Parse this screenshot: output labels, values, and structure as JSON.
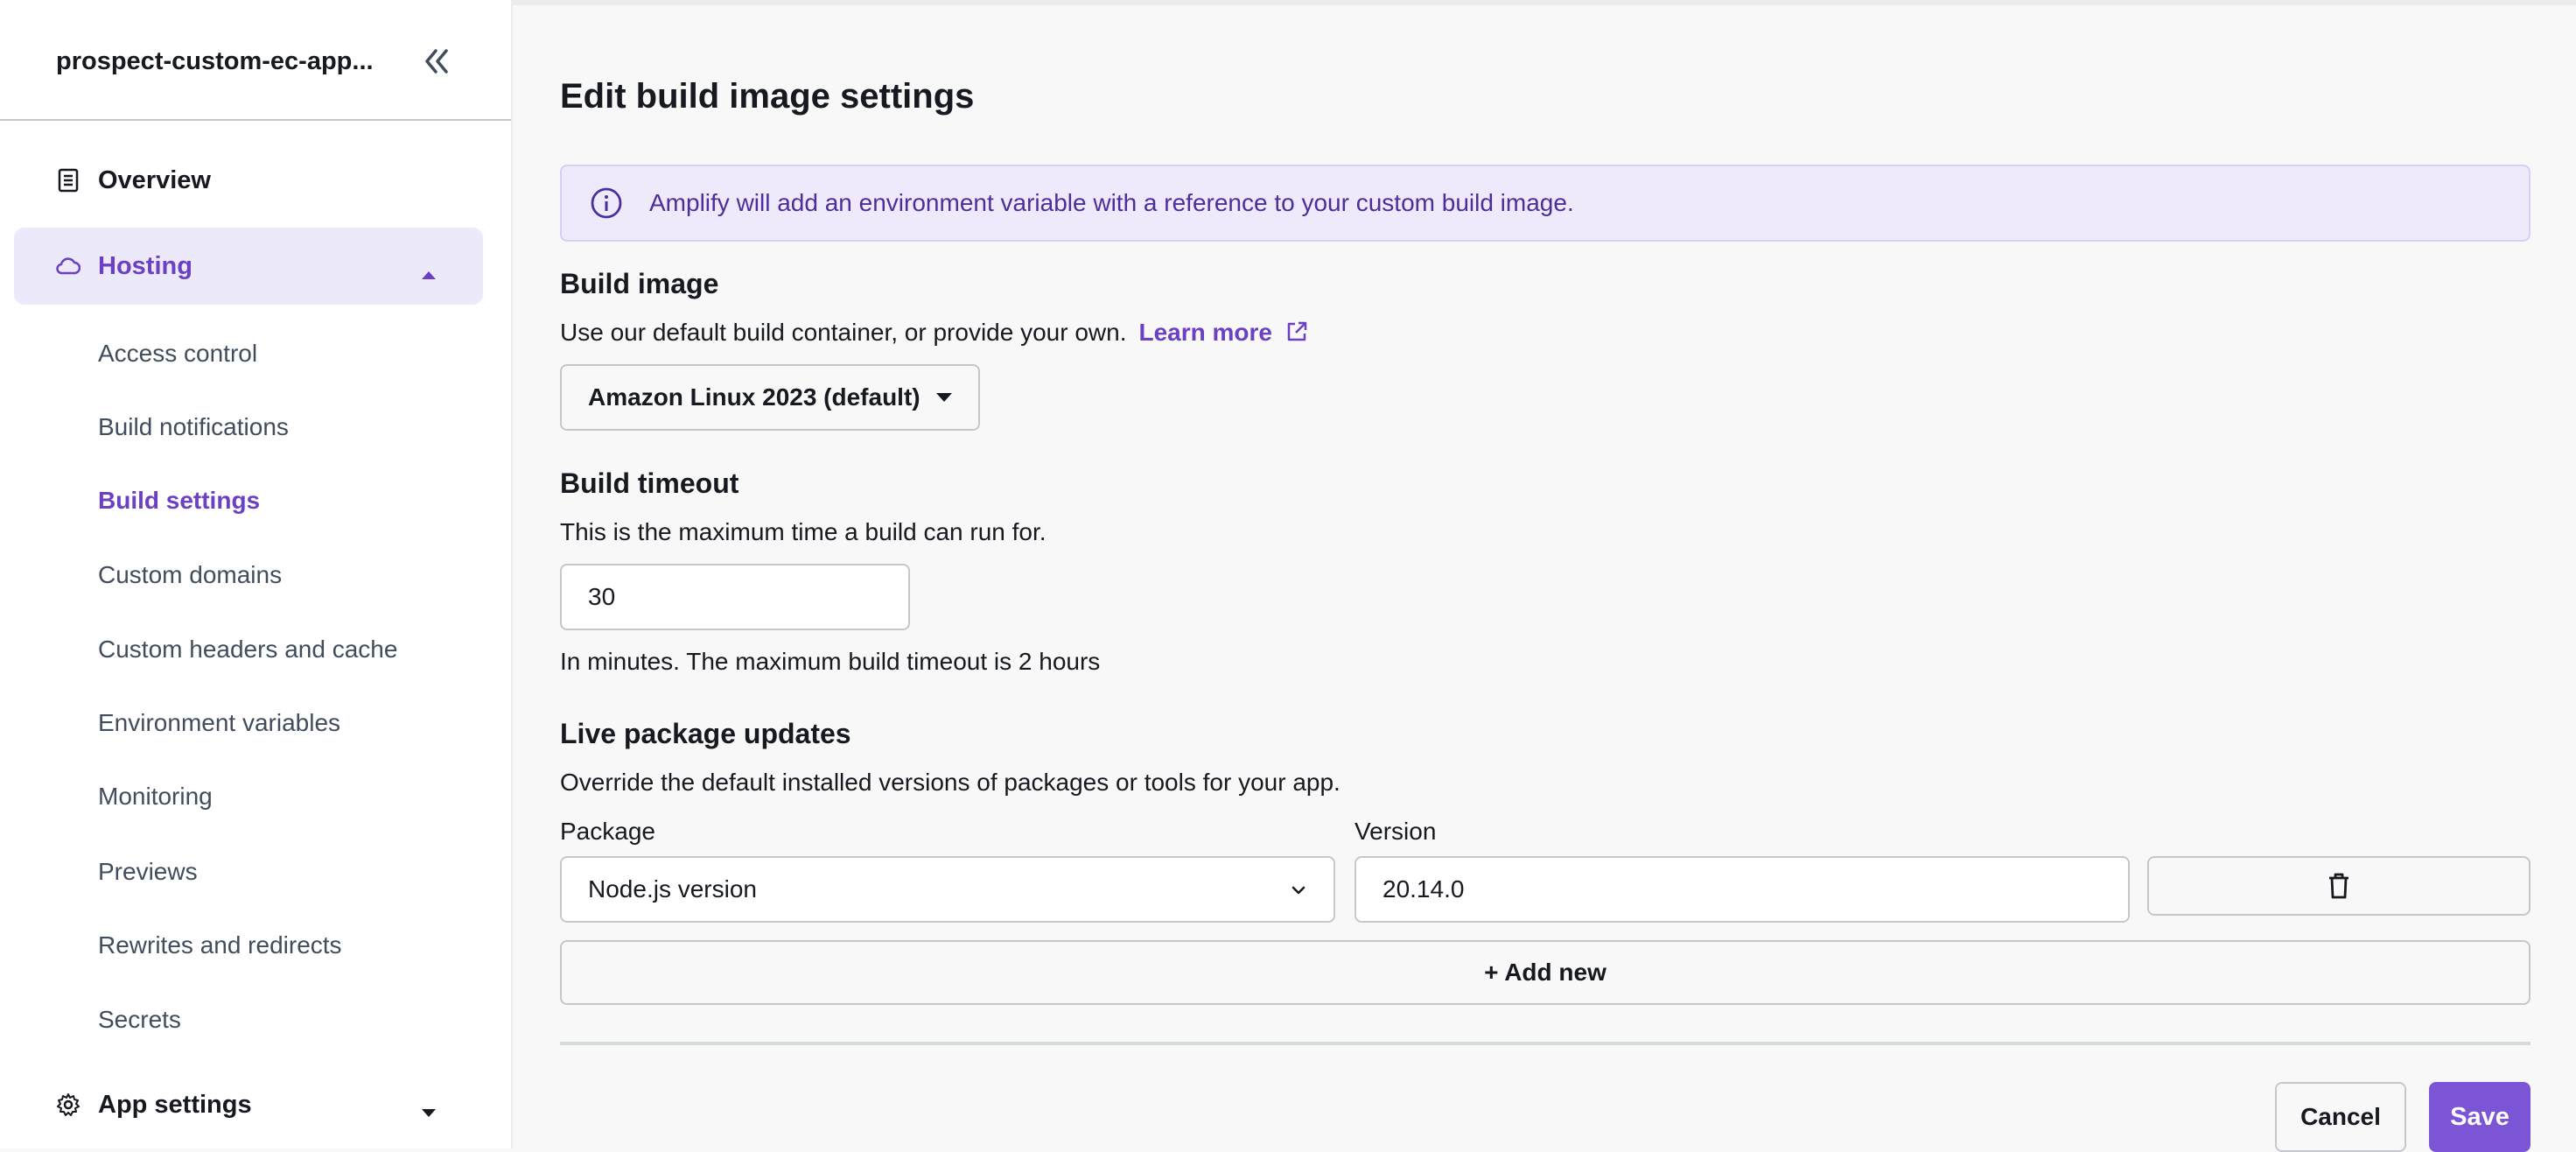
{
  "sidebar": {
    "app_name": "prospect-custom-ec-app...",
    "overview_label": "Overview",
    "hosting_label": "Hosting",
    "sub_items": [
      {
        "label": "Access control"
      },
      {
        "label": "Build notifications"
      },
      {
        "label": "Build settings"
      },
      {
        "label": "Custom domains"
      },
      {
        "label": "Custom headers and cache"
      },
      {
        "label": "Environment variables"
      },
      {
        "label": "Monitoring"
      },
      {
        "label": "Previews"
      },
      {
        "label": "Rewrites and redirects"
      },
      {
        "label": "Secrets"
      }
    ],
    "app_settings_label": "App settings"
  },
  "main": {
    "title": "Edit build image settings",
    "alert_text": "Amplify will add an environment variable with a reference to your custom build image.",
    "build_image": {
      "heading": "Build image",
      "description": "Use our default build container, or provide your own.",
      "learn_more": "Learn more",
      "selected": "Amazon Linux 2023 (default)"
    },
    "build_timeout": {
      "heading": "Build timeout",
      "description": "This is the maximum time a build can run for.",
      "value": "30",
      "hint": "In minutes. The maximum build timeout is 2 hours"
    },
    "live_updates": {
      "heading": "Live package updates",
      "description": "Override the default installed versions of packages or tools for your app.",
      "package_label": "Package",
      "version_label": "Version",
      "package_value": "Node.js version",
      "version_value": "20.14.0",
      "add_new": "+ Add new"
    },
    "cancel_label": "Cancel",
    "save_label": "Save"
  },
  "colors": {
    "accent": "#6b40c4",
    "primary_button": "#7b55d6",
    "alert_bg": "#efeafb"
  },
  "icons": [
    "double-chevron-left-icon",
    "document-icon",
    "cloud-icon",
    "caret-up-icon",
    "gear-icon",
    "caret-down-icon",
    "info-icon",
    "external-link-icon",
    "chevron-down-icon",
    "trash-icon"
  ]
}
